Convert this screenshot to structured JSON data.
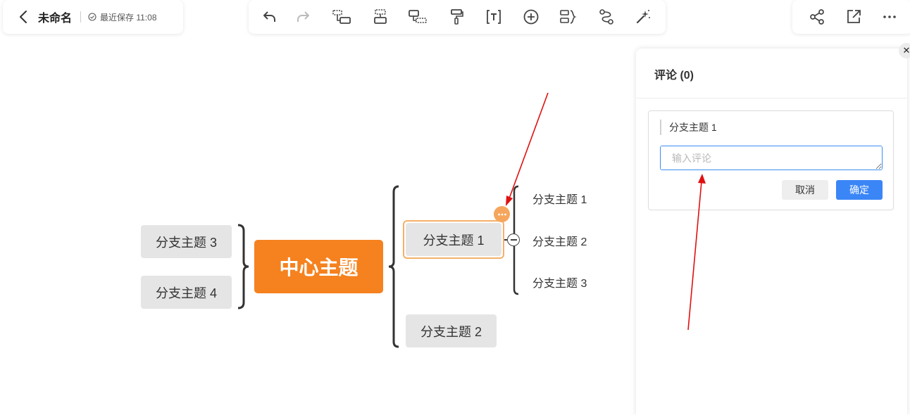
{
  "header": {
    "title": "未命名",
    "save_status": "最近保存 11:08"
  },
  "toolbar": {
    "tools": [
      "undo-icon",
      "redo-icon",
      "insert-child-topic-icon",
      "insert-sibling-topic-icon",
      "insert-parent-topic-icon",
      "format-painter-icon",
      "text-icon",
      "add-icon",
      "summary-icon",
      "relationship-icon",
      "magic-wand-icon"
    ]
  },
  "top_right": {
    "tools": [
      "share-icon",
      "export-icon",
      "more-icon"
    ]
  },
  "mindmap": {
    "center": "中心主题",
    "left_branches": [
      "分支主题 3",
      "分支主题 4"
    ],
    "right_branches": [
      "分支主题 1",
      "分支主题 2"
    ],
    "sub_branches": [
      "分支主题 1",
      "分支主题 2",
      "分支主题 3"
    ]
  },
  "comment_panel": {
    "title": "评论 (0)",
    "quoted_topic": "分支主题 1",
    "input_placeholder": "输入评论",
    "input_value": "",
    "cancel_label": "取消",
    "confirm_label": "确定"
  },
  "colors": {
    "accent": "#f5821f",
    "primary_button": "#3b86f7",
    "annotation_arrow": "#e01010"
  }
}
